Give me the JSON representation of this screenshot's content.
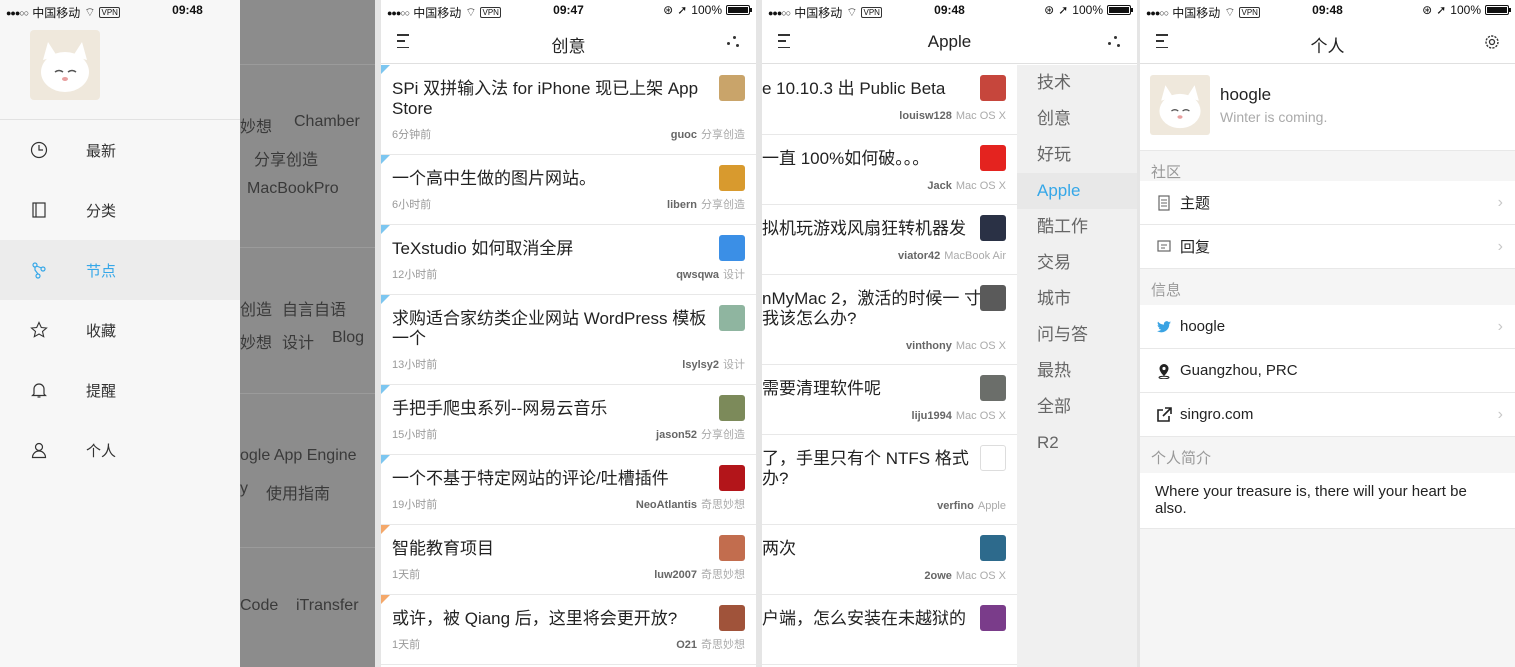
{
  "status": {
    "carrier": "中国移动",
    "vpn": "VPN",
    "battery": "100%",
    "times": [
      "09:48",
      "09:47",
      "09:48",
      "09:48"
    ]
  },
  "drawer": {
    "items": [
      {
        "label": "最新",
        "icon": "clock-icon"
      },
      {
        "label": "分类",
        "icon": "book-icon"
      },
      {
        "label": "节点",
        "icon": "node-icon"
      },
      {
        "label": "收藏",
        "icon": "star-icon"
      },
      {
        "label": "提醒",
        "icon": "bell-icon"
      },
      {
        "label": "个人",
        "icon": "person-icon"
      }
    ],
    "active_index": 2,
    "background_text": [
      "妙想",
      "Chamber",
      "分享创造",
      "MacBookPro",
      "创造",
      "自言自语",
      "妙想",
      "设计",
      "Blog",
      "ogle App Engine",
      "y",
      "使用指南",
      "Code",
      "iTransfer"
    ]
  },
  "creative": {
    "title": "创意",
    "topics": [
      {
        "title": "SPi 双拼输入法 for iPhone 现已上架 App Store",
        "time": "6分钟前",
        "user": "guoc",
        "node": "分享创造",
        "tri": "blue",
        "thumb_color": "#c9a46a"
      },
      {
        "title": "一个高中生做的图片网站。",
        "time": "6小时前",
        "user": "libern",
        "node": "分享创造",
        "tri": "blue",
        "thumb_color": "#d89a2e"
      },
      {
        "title": "TeXstudio 如何取消全屏",
        "time": "12小时前",
        "user": "qwsqwa",
        "node": "设计",
        "tri": "blue",
        "thumb_color": "#3b8fe6"
      },
      {
        "title": "求购适合家纺类企业网站 WordPress 模板一个",
        "time": "13小时前",
        "user": "lsylsy2",
        "node": "设计",
        "tri": "blue",
        "thumb_color": "#8fb5a0"
      },
      {
        "title": "手把手爬虫系列--网易云音乐",
        "time": "15小时前",
        "user": "jason52",
        "node": "分享创造",
        "tri": "blue",
        "thumb_color": "#7c8a5a"
      },
      {
        "title": "一个不基于特定网站的评论/吐槽插件",
        "time": "19小时前",
        "user": "NeoAtlantis",
        "node": "奇思妙想",
        "tri": "blue",
        "thumb_color": "#b3151a"
      },
      {
        "title": "智能教育项目",
        "time": "1天前",
        "user": "luw2007",
        "node": "奇思妙想",
        "tri": "orange",
        "thumb_color": "#c26d4e"
      },
      {
        "title": "或许，被 Qiang 后，这里将会更开放?",
        "time": "1天前",
        "user": "O21",
        "node": "奇思妙想",
        "tri": "orange",
        "thumb_color": "#a0533a"
      }
    ]
  },
  "apple": {
    "title": "Apple",
    "topics": [
      {
        "title": "e 10.10.3 出 Public Beta",
        "user": "louisw128",
        "node": "Mac OS X",
        "thumb_color": "#c6463c"
      },
      {
        "title": "一直 100%如何破。。。",
        "user": "Jack",
        "node": "Mac OS X",
        "thumb_color": "#e4231f"
      },
      {
        "title": "拟机玩游戏风扇狂转机器发",
        "user": "viator42",
        "node": "MacBook Air",
        "thumb_color": "#2a3145"
      },
      {
        "title": "nMyMac 2，激活的时候一 寸 我该怎么办?",
        "user": "vinthony",
        "node": "Mac OS X",
        "thumb_color": "#5a5a5a"
      },
      {
        "title": "需要清理软件呢",
        "user": "liju1994",
        "node": "Mac OS X",
        "thumb_color": "#6b6e6a"
      },
      {
        "title": "了，手里只有个 NTFS 格式 办?",
        "user": "verfino",
        "node": "Apple",
        "thumb_color": "#ffffff"
      },
      {
        "title": "两次",
        "user": "2owe",
        "node": "Mac OS X",
        "thumb_color": "#2d6a8c"
      },
      {
        "title": "户端，怎么安装在未越狱的",
        "user": "",
        "node": "",
        "thumb_color": "#7a3c8a"
      }
    ],
    "sidebar": [
      "技术",
      "创意",
      "好玩",
      "Apple",
      "酷工作",
      "交易",
      "城市",
      "问与答",
      "最热",
      "全部",
      "R2"
    ],
    "sidebar_active": 3
  },
  "profile": {
    "title": "个人",
    "name": "hoogle",
    "signature": "Winter is coming.",
    "community_header": "社区",
    "community": [
      {
        "label": "主题",
        "icon": "document-icon"
      },
      {
        "label": "回复",
        "icon": "reply-icon"
      }
    ],
    "info_header": "信息",
    "info": [
      {
        "label": "hoogle",
        "icon": "twitter-icon"
      },
      {
        "label": "Guangzhou, PRC",
        "icon": "location-icon"
      },
      {
        "label": "singro.com",
        "icon": "external-link-icon"
      }
    ],
    "bio_header": "个人简介",
    "bio": "Where your treasure is, there will your heart be also."
  },
  "colors": {
    "accent": "#35a7e8",
    "triangle_blue": "#7cc6f0",
    "triangle_orange": "#f4a86a"
  }
}
